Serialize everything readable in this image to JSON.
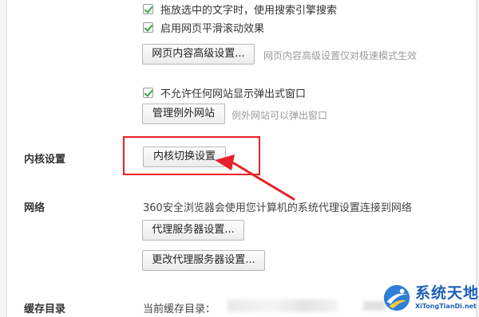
{
  "settings": {
    "drag_search": {
      "checked": true,
      "label": "拖放选中的文字时，使用搜索引擎搜索"
    },
    "smooth_scroll": {
      "checked": true,
      "label": "启用网页平滑滚动效果"
    },
    "advanced_content": {
      "button_label": "网页内容高级设置...",
      "hint": "网页内容高级设置仅对极速模式生效"
    },
    "popups": {
      "checked": true,
      "label": "不允许任何网站显示弹出式窗口",
      "button_label": "管理例外网站",
      "hint": "例外网站可以弹出窗口"
    },
    "kernel": {
      "title": "内核设置",
      "button_label": "内核切换设置"
    },
    "network": {
      "title": "网络",
      "description": "360安全浏览器会使用您计算机的系统代理设置连接到网络",
      "proxy_button_label": "代理服务器设置...",
      "change_proxy_button_label": "更改代理服务器设置..."
    },
    "cache": {
      "title": "缓存目录",
      "current_label": "当前缓存目录："
    }
  },
  "annotation": {
    "color": "#e8202a"
  },
  "watermark": {
    "title": "系统天地",
    "subtitle": "XiTongTianDi.net",
    "color": "#1f5fb8"
  },
  "colors": {
    "checkbox_tick": "#3aa63a",
    "hint_text": "#9a9a9a"
  }
}
